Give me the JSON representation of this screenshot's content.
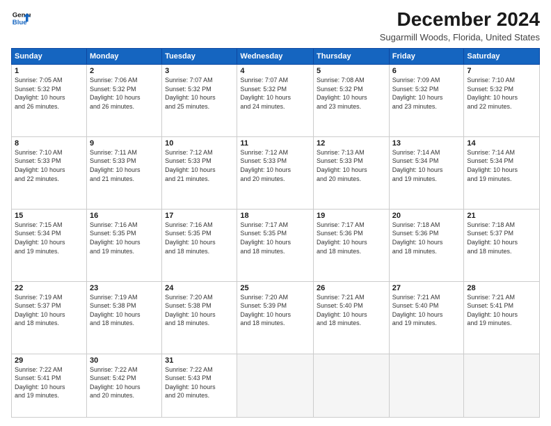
{
  "logo": {
    "line1": "General",
    "line2": "Blue"
  },
  "title": "December 2024",
  "location": "Sugarmill Woods, Florida, United States",
  "headers": [
    "Sunday",
    "Monday",
    "Tuesday",
    "Wednesday",
    "Thursday",
    "Friday",
    "Saturday"
  ],
  "weeks": [
    [
      {
        "day": "1",
        "detail": "Sunrise: 7:05 AM\nSunset: 5:32 PM\nDaylight: 10 hours\nand 26 minutes."
      },
      {
        "day": "2",
        "detail": "Sunrise: 7:06 AM\nSunset: 5:32 PM\nDaylight: 10 hours\nand 26 minutes."
      },
      {
        "day": "3",
        "detail": "Sunrise: 7:07 AM\nSunset: 5:32 PM\nDaylight: 10 hours\nand 25 minutes."
      },
      {
        "day": "4",
        "detail": "Sunrise: 7:07 AM\nSunset: 5:32 PM\nDaylight: 10 hours\nand 24 minutes."
      },
      {
        "day": "5",
        "detail": "Sunrise: 7:08 AM\nSunset: 5:32 PM\nDaylight: 10 hours\nand 23 minutes."
      },
      {
        "day": "6",
        "detail": "Sunrise: 7:09 AM\nSunset: 5:32 PM\nDaylight: 10 hours\nand 23 minutes."
      },
      {
        "day": "7",
        "detail": "Sunrise: 7:10 AM\nSunset: 5:32 PM\nDaylight: 10 hours\nand 22 minutes."
      }
    ],
    [
      {
        "day": "8",
        "detail": "Sunrise: 7:10 AM\nSunset: 5:33 PM\nDaylight: 10 hours\nand 22 minutes."
      },
      {
        "day": "9",
        "detail": "Sunrise: 7:11 AM\nSunset: 5:33 PM\nDaylight: 10 hours\nand 21 minutes."
      },
      {
        "day": "10",
        "detail": "Sunrise: 7:12 AM\nSunset: 5:33 PM\nDaylight: 10 hours\nand 21 minutes."
      },
      {
        "day": "11",
        "detail": "Sunrise: 7:12 AM\nSunset: 5:33 PM\nDaylight: 10 hours\nand 20 minutes."
      },
      {
        "day": "12",
        "detail": "Sunrise: 7:13 AM\nSunset: 5:33 PM\nDaylight: 10 hours\nand 20 minutes."
      },
      {
        "day": "13",
        "detail": "Sunrise: 7:14 AM\nSunset: 5:34 PM\nDaylight: 10 hours\nand 19 minutes."
      },
      {
        "day": "14",
        "detail": "Sunrise: 7:14 AM\nSunset: 5:34 PM\nDaylight: 10 hours\nand 19 minutes."
      }
    ],
    [
      {
        "day": "15",
        "detail": "Sunrise: 7:15 AM\nSunset: 5:34 PM\nDaylight: 10 hours\nand 19 minutes."
      },
      {
        "day": "16",
        "detail": "Sunrise: 7:16 AM\nSunset: 5:35 PM\nDaylight: 10 hours\nand 19 minutes."
      },
      {
        "day": "17",
        "detail": "Sunrise: 7:16 AM\nSunset: 5:35 PM\nDaylight: 10 hours\nand 18 minutes."
      },
      {
        "day": "18",
        "detail": "Sunrise: 7:17 AM\nSunset: 5:35 PM\nDaylight: 10 hours\nand 18 minutes."
      },
      {
        "day": "19",
        "detail": "Sunrise: 7:17 AM\nSunset: 5:36 PM\nDaylight: 10 hours\nand 18 minutes."
      },
      {
        "day": "20",
        "detail": "Sunrise: 7:18 AM\nSunset: 5:36 PM\nDaylight: 10 hours\nand 18 minutes."
      },
      {
        "day": "21",
        "detail": "Sunrise: 7:18 AM\nSunset: 5:37 PM\nDaylight: 10 hours\nand 18 minutes."
      }
    ],
    [
      {
        "day": "22",
        "detail": "Sunrise: 7:19 AM\nSunset: 5:37 PM\nDaylight: 10 hours\nand 18 minutes."
      },
      {
        "day": "23",
        "detail": "Sunrise: 7:19 AM\nSunset: 5:38 PM\nDaylight: 10 hours\nand 18 minutes."
      },
      {
        "day": "24",
        "detail": "Sunrise: 7:20 AM\nSunset: 5:38 PM\nDaylight: 10 hours\nand 18 minutes."
      },
      {
        "day": "25",
        "detail": "Sunrise: 7:20 AM\nSunset: 5:39 PM\nDaylight: 10 hours\nand 18 minutes."
      },
      {
        "day": "26",
        "detail": "Sunrise: 7:21 AM\nSunset: 5:40 PM\nDaylight: 10 hours\nand 18 minutes."
      },
      {
        "day": "27",
        "detail": "Sunrise: 7:21 AM\nSunset: 5:40 PM\nDaylight: 10 hours\nand 19 minutes."
      },
      {
        "day": "28",
        "detail": "Sunrise: 7:21 AM\nSunset: 5:41 PM\nDaylight: 10 hours\nand 19 minutes."
      }
    ],
    [
      {
        "day": "29",
        "detail": "Sunrise: 7:22 AM\nSunset: 5:41 PM\nDaylight: 10 hours\nand 19 minutes."
      },
      {
        "day": "30",
        "detail": "Sunrise: 7:22 AM\nSunset: 5:42 PM\nDaylight: 10 hours\nand 20 minutes."
      },
      {
        "day": "31",
        "detail": "Sunrise: 7:22 AM\nSunset: 5:43 PM\nDaylight: 10 hours\nand 20 minutes."
      },
      {
        "day": "",
        "detail": ""
      },
      {
        "day": "",
        "detail": ""
      },
      {
        "day": "",
        "detail": ""
      },
      {
        "day": "",
        "detail": ""
      }
    ]
  ]
}
